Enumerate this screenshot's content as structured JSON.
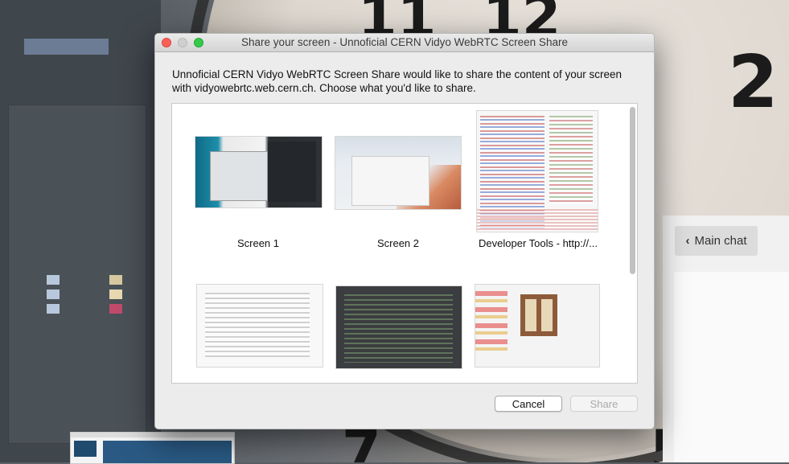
{
  "dialog": {
    "title": "Share your screen - Unnoficial CERN Vidyo WebRTC Screen Share",
    "description": "Unnoficial CERN Vidyo WebRTC Screen Share would like to share the content of your screen with vidyowebrtc.web.cern.ch. Choose what you'd like to share.",
    "sources": [
      {
        "label": "Screen 1"
      },
      {
        "label": "Screen 2"
      },
      {
        "label": "Developer Tools - http://..."
      },
      {
        "label": ""
      },
      {
        "label": ""
      },
      {
        "label": ""
      }
    ],
    "cancel_label": "Cancel",
    "share_label": "Share",
    "share_enabled": false
  },
  "chat": {
    "back_label": "Main chat",
    "back_icon": "chevron-left-icon"
  },
  "colors": {
    "close": "#fc5f57",
    "minimize": "#d0d0d0",
    "maximize": "#35c94a"
  }
}
